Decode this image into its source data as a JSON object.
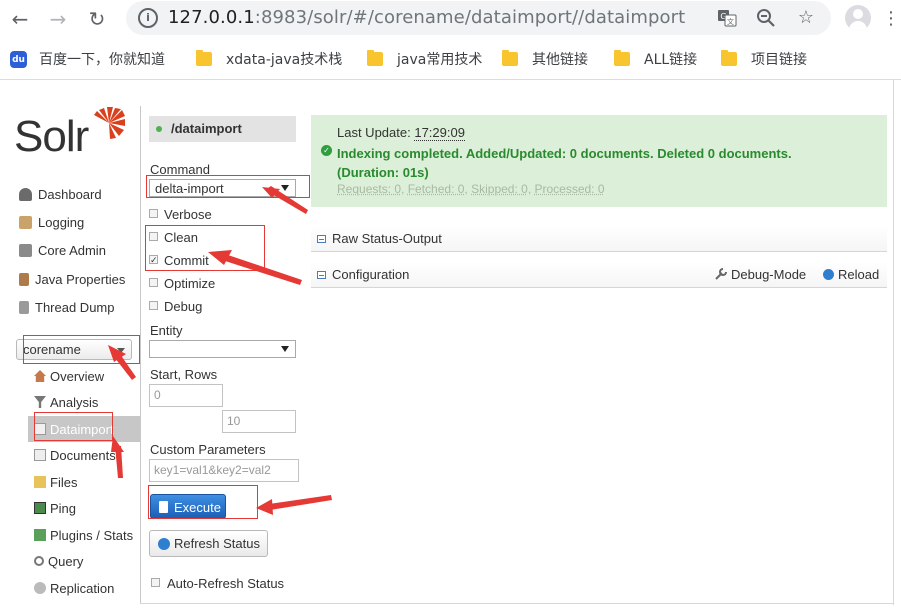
{
  "browser": {
    "url_host": "127.0.0.1",
    "url_rest": ":8983/solr/#/corename/dataimport//dataimport",
    "bookmarks": [
      "百度一下，你就知道",
      "xdata-java技术栈",
      "java常用技术",
      "其他链接",
      "ALL链接",
      "项目链接"
    ]
  },
  "brand": {
    "logo_text": "Solr",
    "logo_color": "#d9411e"
  },
  "sidebar": {
    "items": [
      {
        "label": "Dashboard",
        "icon": "dashboard-icon"
      },
      {
        "label": "Logging",
        "icon": "logging-icon"
      },
      {
        "label": "Core Admin",
        "icon": "core-admin-icon"
      },
      {
        "label": "Java Properties",
        "icon": "java-properties-icon"
      },
      {
        "label": "Thread Dump",
        "icon": "thread-dump-icon"
      }
    ],
    "core_selector": "corename",
    "core_items": [
      {
        "label": "Overview",
        "icon": "home-icon"
      },
      {
        "label": "Analysis",
        "icon": "funnel-icon"
      },
      {
        "label": "Dataimport",
        "icon": "dataimport-icon"
      },
      {
        "label": "Documents",
        "icon": "documents-icon"
      },
      {
        "label": "Files",
        "icon": "folder-icon"
      },
      {
        "label": "Ping",
        "icon": "ping-icon"
      },
      {
        "label": "Plugins / Stats",
        "icon": "plugins-icon"
      },
      {
        "label": "Query",
        "icon": "magnifier-icon"
      },
      {
        "label": "Replication",
        "icon": "replication-icon"
      }
    ],
    "selected_core_item": "Dataimport"
  },
  "form": {
    "handler": "/dataimport",
    "command_label": "Command",
    "command_value": "delta-import",
    "verbose_label": "Verbose",
    "clean_label": "Clean",
    "commit_label": "Commit",
    "optimize_label": "Optimize",
    "debug_label": "Debug",
    "entity_label": "Entity",
    "entity_value": "",
    "start_rows_label": "Start, Rows",
    "start_value": "0",
    "rows_value": "10",
    "custom_params_label": "Custom Parameters",
    "custom_params_placeholder": "key1=val1&key2=val2",
    "execute_label": "Execute",
    "refresh_label": "Refresh Status",
    "auto_refresh_label": "Auto-Refresh Status",
    "checked": {
      "verbose": false,
      "clean": false,
      "commit": true,
      "optimize": false,
      "debug": false,
      "auto_refresh": false
    }
  },
  "status": {
    "last_update_label": "Last Update:",
    "last_update_time": "17:29:09",
    "message_line1": "Indexing completed. Added/Updated: 0 documents. Deleted 0 documents.",
    "message_line2": "(Duration: 01s)",
    "requests": "Requests: 0",
    "fetched": "Fetched: 0",
    "skipped": "Skipped: 0",
    "processed": "Processed: 0",
    "success_color": "#2a8a2f"
  },
  "sections": {
    "raw_status": "Raw Status-Output",
    "configuration": "Configuration",
    "debug_mode": "Debug-Mode",
    "reload": "Reload"
  },
  "annotation_color": "#e53935"
}
